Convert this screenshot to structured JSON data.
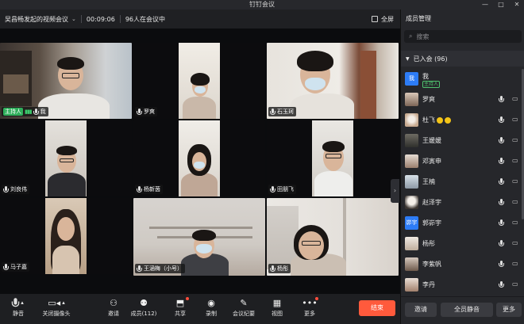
{
  "window": {
    "title": "钉钉会议",
    "controls": [
      "—",
      "□",
      "✕"
    ]
  },
  "meeting": {
    "name": "吴昌畅发起的视频会议",
    "duration": "00:09:06",
    "participants_text": "96人在会议中",
    "fullscreen_label": "全屏"
  },
  "tiles": [
    {
      "name": "我",
      "host_label": "主持人",
      "signal": "▮▮▮",
      "mic": "on"
    },
    {
      "name": "罗爽",
      "mic": "on"
    },
    {
      "name": "石玉珂",
      "mic": "on"
    },
    {
      "name": "刘良伟",
      "mic": "on"
    },
    {
      "name": "杨新茵",
      "mic": "on"
    },
    {
      "name": "田朋飞",
      "mic": "on"
    },
    {
      "name": "马子嘉",
      "mic": "on"
    },
    {
      "name": "王涵梅（小号）",
      "mic": "on"
    },
    {
      "name": "杨彤",
      "mic": "on"
    }
  ],
  "toolbar": {
    "mute": "静音",
    "camera": "关闭摄像头",
    "invite": "邀请",
    "members": "成员(112)",
    "share": "共享",
    "record": "录制",
    "minutes": "会议纪要",
    "view": "视图",
    "more": "更多",
    "end": "结束"
  },
  "panel": {
    "title": "成员管理",
    "search_placeholder": "搜索",
    "group_label": "已入会 (96)",
    "members": [
      {
        "name": "我",
        "avatar_text": "我",
        "subtitle": "主持人"
      },
      {
        "name": "罗爽"
      },
      {
        "name": "杜飞"
      },
      {
        "name": "王媛媛"
      },
      {
        "name": "邓寅申"
      },
      {
        "name": "王楠"
      },
      {
        "name": "赵泽宇"
      },
      {
        "name": "郭峁宇",
        "avatar_text": "峁宇"
      },
      {
        "name": "杨彤"
      },
      {
        "name": "李紫帆"
      },
      {
        "name": "李丹"
      }
    ],
    "invite_button": "邀请",
    "mute_all_button": "全员静音",
    "more_button": "更多"
  }
}
